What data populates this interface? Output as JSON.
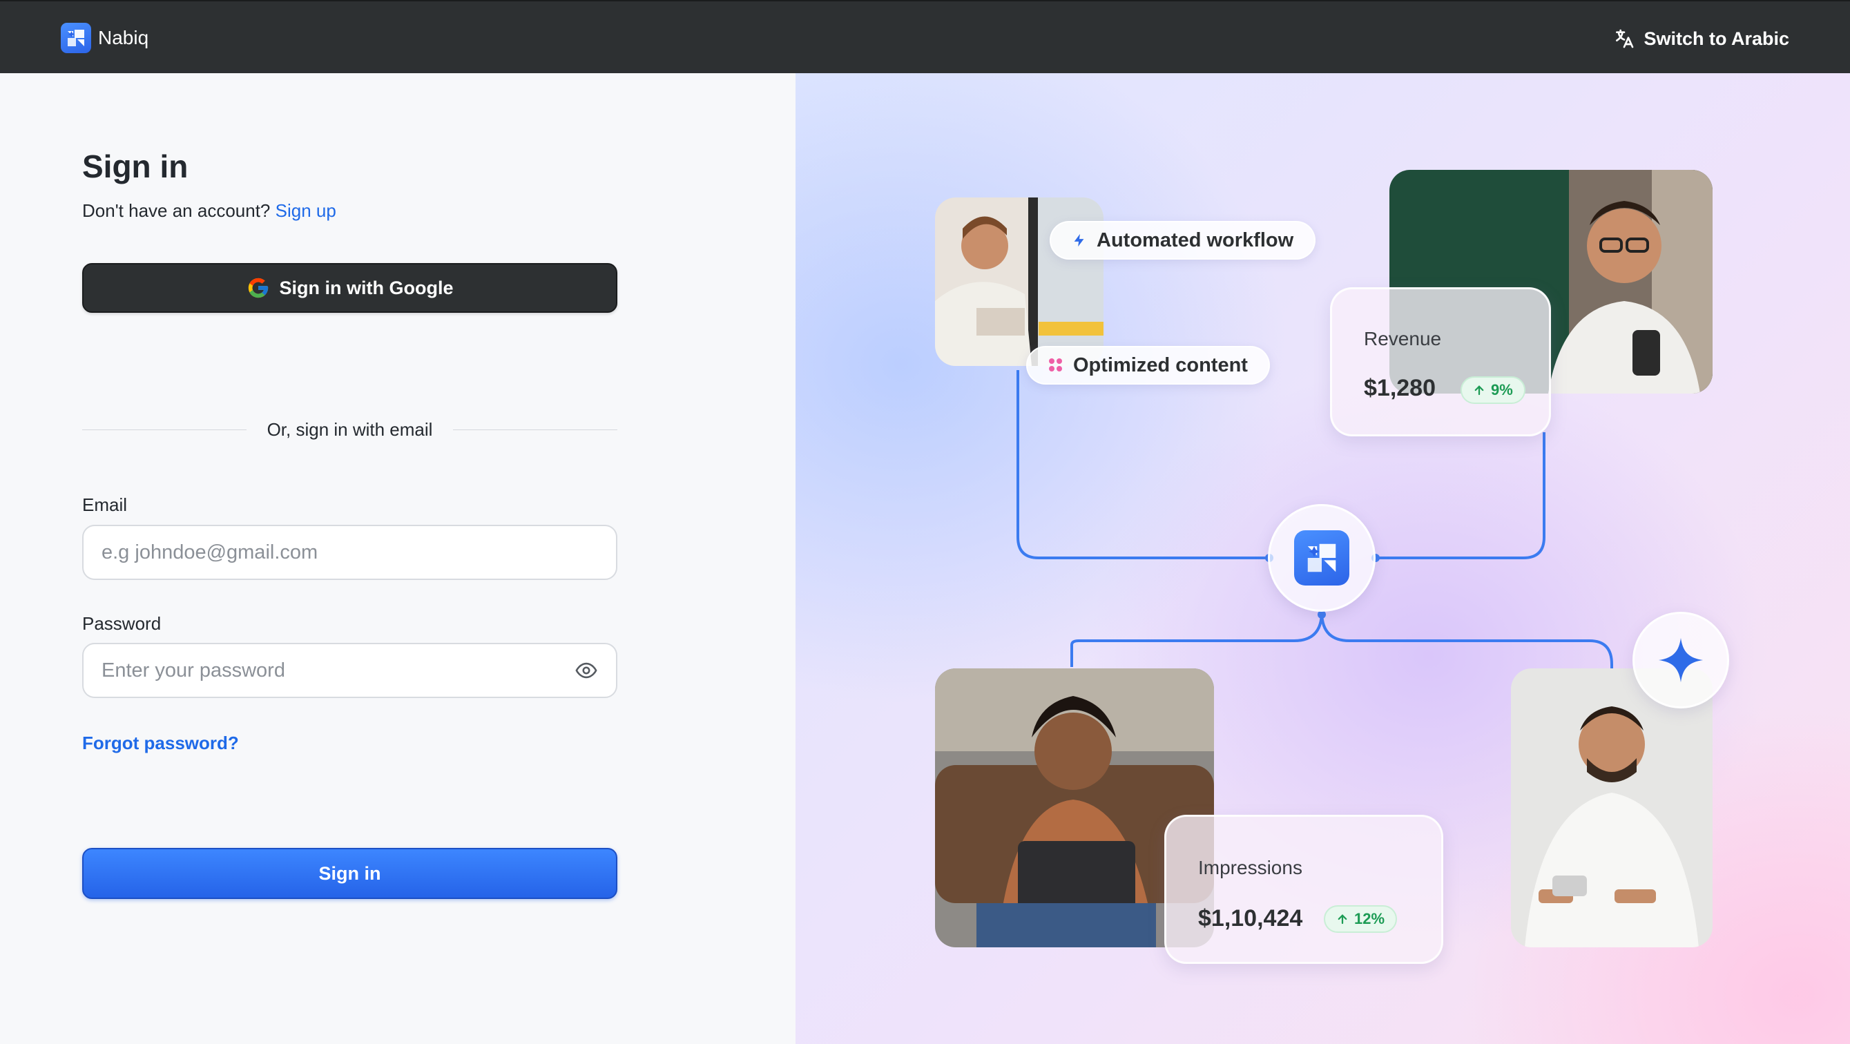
{
  "header": {
    "brand_name": "Nabiq",
    "switch_language_label": "Switch to Arabic"
  },
  "signin": {
    "title": "Sign in",
    "no_account_text": "Don't have an account?",
    "signup_link": "Sign up",
    "google_button": "Sign in with Google",
    "divider_text": "Or, sign in with email",
    "email_label": "Email",
    "email_placeholder": "e.g johndoe@gmail.com",
    "email_value": "",
    "password_label": "Password",
    "password_placeholder": "Enter your password",
    "password_value": "",
    "forgot_password": "Forgot password?",
    "submit_button": "Sign in"
  },
  "illustration": {
    "pill_automated": "Automated workflow",
    "pill_optimized": "Optimized content",
    "revenue_card": {
      "title": "Revenue",
      "value": "$1,280",
      "change": "9%"
    },
    "impressions_card": {
      "title": "Impressions",
      "value": "$1,10,424",
      "change": "12%"
    }
  },
  "colors": {
    "topbar": "#2d3032",
    "accent_blue": "#2563e8",
    "link_blue": "#1f6ae8",
    "positive_green": "#1c9b54"
  },
  "icons": {
    "brand": "nabiq-logo-icon",
    "translate": "translate-icon",
    "google": "google-g-icon",
    "eye": "eye-icon",
    "bolt": "lightning-icon",
    "grid": "dots-grid-icon",
    "arrow_up": "arrow-up-icon",
    "sparkle": "sparkle-icon"
  }
}
